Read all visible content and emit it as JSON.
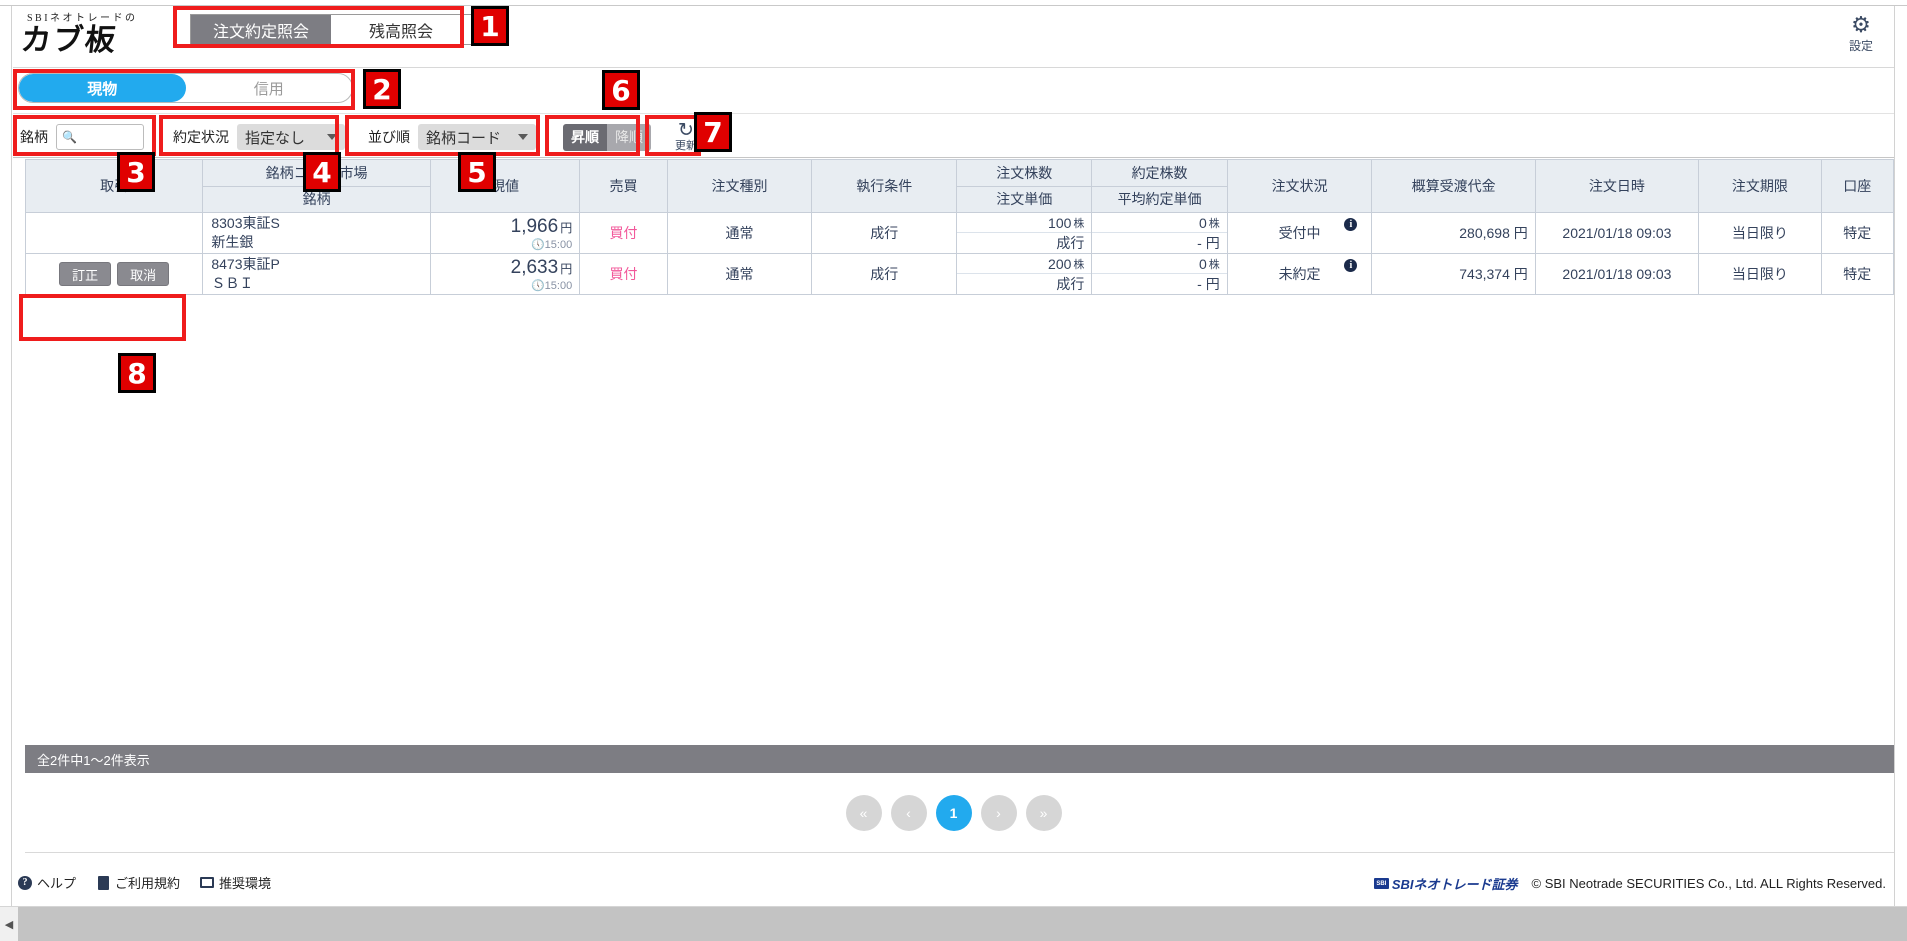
{
  "header": {
    "logo_small": "SBIネオトレードの",
    "logo_main": "カブ板",
    "settings_label": "設定",
    "tabs": [
      {
        "label": "注文約定照会",
        "active": true
      },
      {
        "label": "残高照会",
        "active": false
      }
    ]
  },
  "segment": {
    "items": [
      {
        "label": "現物",
        "active": true
      },
      {
        "label": "信用",
        "active": false
      }
    ]
  },
  "filters": {
    "stock_label": "銘柄",
    "stock_value": "",
    "stock_placeholder": "",
    "search_icon": "search-icon",
    "status_label": "約定状況",
    "status_value": "指定なし",
    "sort_label": "並び順",
    "sort_value": "銘柄コード",
    "order": [
      {
        "label": "昇順",
        "active": true
      },
      {
        "label": "降順",
        "active": false
      }
    ],
    "refresh_icon": "refresh-icon",
    "refresh_label": "更新"
  },
  "table": {
    "headers": {
      "trade": "取引",
      "code_market": "銘柄コード/市場",
      "name": "銘柄",
      "current_price": "現値",
      "side": "売買",
      "order_type": "注文種別",
      "exec_condition": "執行条件",
      "order_qty": "注文株数",
      "order_price": "注文単価",
      "exec_qty": "約定株数",
      "avg_exec_price": "平均約定単価",
      "order_status": "注文状況",
      "settlement_amount": "概算受渡代金",
      "order_datetime": "注文日時",
      "order_expiry": "注文期限",
      "account": "口座"
    },
    "rows": [
      {
        "actions": [],
        "code_market": "8303東証S",
        "name": "新生銀",
        "price": "1,966",
        "price_unit": "円",
        "price_time": "15:00",
        "side": "買付",
        "order_type": "通常",
        "exec_condition": "成行",
        "order_qty": "100",
        "order_qty_unit": "株",
        "order_price": "成行",
        "exec_qty": "0",
        "exec_qty_unit": "株",
        "avg_exec_price": "- 円",
        "order_status": "受付中",
        "info_icon": "info-icon",
        "settlement_amount": "280,698 円",
        "order_datetime": "2021/01/18 09:03",
        "order_expiry": "当日限り",
        "account": "特定"
      },
      {
        "actions": [
          "訂正",
          "取消"
        ],
        "code_market": "8473東証P",
        "name": "ＳＢＩ",
        "price": "2,633",
        "price_unit": "円",
        "price_time": "15:00",
        "side": "買付",
        "order_type": "通常",
        "exec_condition": "成行",
        "order_qty": "200",
        "order_qty_unit": "株",
        "order_price": "成行",
        "exec_qty": "0",
        "exec_qty_unit": "株",
        "avg_exec_price": "- 円",
        "order_status": "未約定",
        "info_icon": "info-icon",
        "settlement_amount": "743,374 円",
        "order_datetime": "2021/01/18 09:03",
        "order_expiry": "当日限り",
        "account": "特定"
      }
    ]
  },
  "results": {
    "summary": "全2件中1～2件表示"
  },
  "pagination": {
    "first": "«",
    "prev": "‹",
    "current": "1",
    "next": "›",
    "last": "»"
  },
  "footer": {
    "links": [
      {
        "label": "ヘルプ",
        "icon": "help-icon"
      },
      {
        "label": "ご利用規約",
        "icon": "document-icon"
      },
      {
        "label": "推奨環境",
        "icon": "monitor-icon"
      }
    ],
    "brand_mark": "SBI",
    "brand": "SBIネオトレード証券",
    "copyright": "© SBI Neotrade SECURITIES Co., Ltd. ALL Rights Reserved."
  },
  "annotations": [
    {
      "num": "1"
    },
    {
      "num": "2"
    },
    {
      "num": "3"
    },
    {
      "num": "4"
    },
    {
      "num": "5"
    },
    {
      "num": "6"
    },
    {
      "num": "7"
    },
    {
      "num": "8"
    }
  ],
  "colors": {
    "accent": "#22aaee",
    "tab_active": "#7d7d83",
    "buy": "#f2589a",
    "annotation": "#e00000",
    "table_header": "#e8edf2",
    "text": "#34425c"
  }
}
